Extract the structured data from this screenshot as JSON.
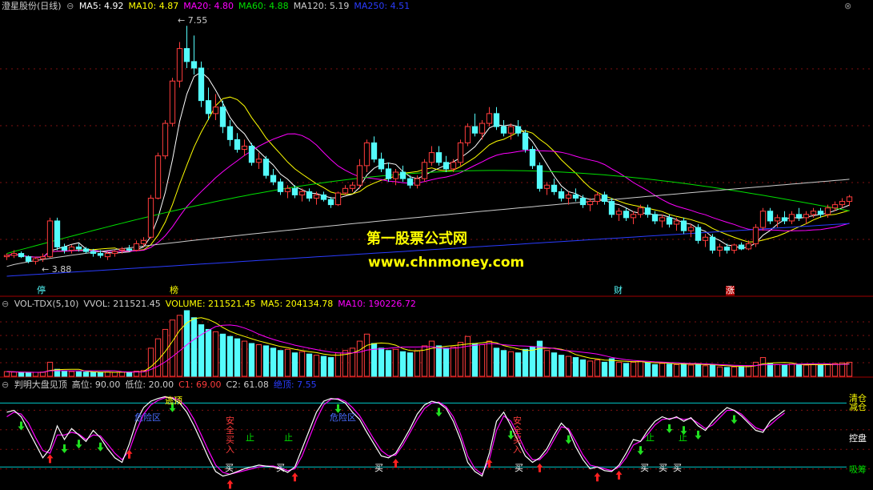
{
  "title": "澄星股份(日线)",
  "colors": {
    "up": "#ff3c3c",
    "down": "#54fcfc",
    "ma5": "#ffffff",
    "ma10": "#ffff00",
    "ma20": "#ff00ff",
    "ma60": "#00e000",
    "ma120": "#cccccc",
    "ma250": "#2a3cff",
    "grid": "#801010",
    "divider": "#a00000",
    "level": "#00c8c8"
  },
  "price_panel": {
    "legend": [
      {
        "label": "MA5: 4.92",
        "color": "#ffffff"
      },
      {
        "label": "MA10: 4.87",
        "color": "#ffff00"
      },
      {
        "label": "MA20: 4.80",
        "color": "#ff00ff"
      },
      {
        "label": "MA60: 4.88",
        "color": "#00e000"
      },
      {
        "label": "MA120: 5.19",
        "color": "#cccccc"
      },
      {
        "label": "MA250: 4.51",
        "color": "#2a3cff"
      }
    ],
    "high_label": "7.55",
    "low_label": "3.88",
    "watermark_title": "第一股票公式网",
    "watermark_url": "www.chnmoney.com",
    "event_tags": [
      "停",
      "榜",
      "财",
      "涨"
    ]
  },
  "volume_panel": {
    "legend": [
      {
        "label": "VOL-TDX(5,10)",
        "color": "#cccccc"
      },
      {
        "label": "VVOL: 211521.45",
        "color": "#cccccc"
      },
      {
        "label": "VOLUME: 211521.45",
        "color": "#ffff00"
      },
      {
        "label": "MA5: 204134.78",
        "color": "#ffff00"
      },
      {
        "label": "MA10: 190226.72",
        "color": "#ff00ff"
      }
    ]
  },
  "indicator_panel": {
    "legend": [
      {
        "label": "判明大盘见顶",
        "color": "#cccccc"
      },
      {
        "label": "高位: 90.00",
        "color": "#cccccc"
      },
      {
        "label": "低位: 20.00",
        "color": "#cccccc"
      },
      {
        "label": "C1: 69.00",
        "color": "#ff3c3c"
      },
      {
        "label": "C2: 61.08",
        "color": "#cccccc"
      },
      {
        "label": "绝顶: 7.55",
        "color": "#2a3cff"
      }
    ],
    "right_labels": {
      "top": "清仓",
      "top2": "减仓",
      "mid": "控盘",
      "bottom": "吸筹"
    },
    "annotations": {
      "escape_top": "逃顶",
      "danger_zone": "危险区",
      "safe_buy": "安全买入",
      "stop": "止",
      "buy": "买"
    }
  },
  "chart_data": [
    {
      "type": "candlestick",
      "title": "澄星股份(日线)",
      "y_high": 7.55,
      "y_low": 3.88,
      "ohlc": [
        [
          4.0,
          4.05,
          3.95,
          4.02
        ],
        [
          4.02,
          4.1,
          3.98,
          4.05
        ],
        [
          4.05,
          4.08,
          3.98,
          4.0
        ],
        [
          4.0,
          4.02,
          3.9,
          3.93
        ],
        [
          3.93,
          4.0,
          3.88,
          3.97
        ],
        [
          3.97,
          4.05,
          3.92,
          4.0
        ],
        [
          4.0,
          4.6,
          3.98,
          4.55
        ],
        [
          4.55,
          4.6,
          4.1,
          4.15
        ],
        [
          4.15,
          4.2,
          4.05,
          4.1
        ],
        [
          4.1,
          4.18,
          4.05,
          4.15
        ],
        [
          4.15,
          4.2,
          4.08,
          4.12
        ],
        [
          4.12,
          4.15,
          4.05,
          4.08
        ],
        [
          4.08,
          4.12,
          4.0,
          4.05
        ],
        [
          4.05,
          4.1,
          3.98,
          4.02
        ],
        [
          4.0,
          4.08,
          3.95,
          4.05
        ],
        [
          4.05,
          4.1,
          4.0,
          4.08
        ],
        [
          4.1,
          4.15,
          4.05,
          4.12
        ],
        [
          4.12,
          4.18,
          4.08,
          4.1
        ],
        [
          4.1,
          4.25,
          4.08,
          4.2
        ],
        [
          4.2,
          4.3,
          4.15,
          4.25
        ],
        [
          4.3,
          4.95,
          4.28,
          4.9
        ],
        [
          4.9,
          5.6,
          4.88,
          5.55
        ],
        [
          5.55,
          6.1,
          5.5,
          6.05
        ],
        [
          6.05,
          6.75,
          6.0,
          6.7
        ],
        [
          6.7,
          7.3,
          6.6,
          7.2
        ],
        [
          7.2,
          7.55,
          6.9,
          7.0
        ],
        [
          7.0,
          7.4,
          6.8,
          6.9
        ],
        [
          6.9,
          7.0,
          6.3,
          6.4
        ],
        [
          6.4,
          6.6,
          6.1,
          6.2
        ],
        [
          6.2,
          6.5,
          6.1,
          6.3
        ],
        [
          6.3,
          6.4,
          5.9,
          6.0
        ],
        [
          6.0,
          6.1,
          5.7,
          5.8
        ],
        [
          5.8,
          5.9,
          5.6,
          5.65
        ],
        [
          5.65,
          5.8,
          5.55,
          5.7
        ],
        [
          5.7,
          5.75,
          5.4,
          5.45
        ],
        [
          5.45,
          5.6,
          5.35,
          5.5
        ],
        [
          5.5,
          5.55,
          5.2,
          5.25
        ],
        [
          5.25,
          5.35,
          5.1,
          5.15
        ],
        [
          5.15,
          5.2,
          4.95,
          5.0
        ],
        [
          5.0,
          5.1,
          4.9,
          5.05
        ],
        [
          5.05,
          5.1,
          4.9,
          4.95
        ],
        [
          4.95,
          5.05,
          4.85,
          5.0
        ],
        [
          5.0,
          5.05,
          4.85,
          4.9
        ],
        [
          4.9,
          5.0,
          4.8,
          4.95
        ],
        [
          4.95,
          5.0,
          4.85,
          4.88
        ],
        [
          4.88,
          4.92,
          4.75,
          4.8
        ],
        [
          4.8,
          5.0,
          4.78,
          4.98
        ],
        [
          4.98,
          5.1,
          4.95,
          5.05
        ],
        [
          5.05,
          5.15,
          5.0,
          5.1
        ],
        [
          5.1,
          5.5,
          5.05,
          5.4
        ],
        [
          5.4,
          5.8,
          5.3,
          5.75
        ],
        [
          5.75,
          5.85,
          5.45,
          5.5
        ],
        [
          5.5,
          5.6,
          5.3,
          5.35
        ],
        [
          5.35,
          5.45,
          5.15,
          5.2
        ],
        [
          5.2,
          5.35,
          5.1,
          5.3
        ],
        [
          5.3,
          5.4,
          5.15,
          5.2
        ],
        [
          5.2,
          5.25,
          5.05,
          5.1
        ],
        [
          5.1,
          5.25,
          5.05,
          5.2
        ],
        [
          5.2,
          5.5,
          5.15,
          5.45
        ],
        [
          5.45,
          5.7,
          5.4,
          5.6
        ],
        [
          5.6,
          5.7,
          5.4,
          5.45
        ],
        [
          5.45,
          5.55,
          5.3,
          5.35
        ],
        [
          5.35,
          5.5,
          5.3,
          5.45
        ],
        [
          5.45,
          5.8,
          5.4,
          5.75
        ],
        [
          5.75,
          6.05,
          5.7,
          6.0
        ],
        [
          6.0,
          6.2,
          5.85,
          5.9
        ],
        [
          5.9,
          6.1,
          5.8,
          6.05
        ],
        [
          6.05,
          6.3,
          6.0,
          6.2
        ],
        [
          6.2,
          6.3,
          5.95,
          6.0
        ],
        [
          6.0,
          6.1,
          5.85,
          5.9
        ],
        [
          5.9,
          6.05,
          5.8,
          6.0
        ],
        [
          6.0,
          6.1,
          5.85,
          5.9
        ],
        [
          5.9,
          5.95,
          5.6,
          5.65
        ],
        [
          5.65,
          5.7,
          5.35,
          5.4
        ],
        [
          5.4,
          5.45,
          5.0,
          5.05
        ],
        [
          5.05,
          5.15,
          4.95,
          5.1
        ],
        [
          5.1,
          5.2,
          4.95,
          5.0
        ],
        [
          5.0,
          5.05,
          4.85,
          4.9
        ],
        [
          4.9,
          5.0,
          4.8,
          4.95
        ],
        [
          4.95,
          5.05,
          4.85,
          4.9
        ],
        [
          4.9,
          4.95,
          4.75,
          4.8
        ],
        [
          4.8,
          4.9,
          4.7,
          4.85
        ],
        [
          4.85,
          5.0,
          4.8,
          4.95
        ],
        [
          4.95,
          5.0,
          4.8,
          4.85
        ],
        [
          4.85,
          4.9,
          4.6,
          4.65
        ],
        [
          4.65,
          4.75,
          4.55,
          4.7
        ],
        [
          4.7,
          4.75,
          4.55,
          4.6
        ],
        [
          4.6,
          4.7,
          4.5,
          4.65
        ],
        [
          4.65,
          4.8,
          4.6,
          4.75
        ],
        [
          4.75,
          4.8,
          4.6,
          4.65
        ],
        [
          4.65,
          4.7,
          4.5,
          4.55
        ],
        [
          4.55,
          4.65,
          4.45,
          4.6
        ],
        [
          4.6,
          4.65,
          4.45,
          4.5
        ],
        [
          4.5,
          4.6,
          4.4,
          4.55
        ],
        [
          4.55,
          4.6,
          4.35,
          4.4
        ],
        [
          4.4,
          4.5,
          4.3,
          4.45
        ],
        [
          4.45,
          4.5,
          4.2,
          4.25
        ],
        [
          4.25,
          4.35,
          4.15,
          4.3
        ],
        [
          4.3,
          4.35,
          4.05,
          4.1
        ],
        [
          4.1,
          4.2,
          4.0,
          4.15
        ],
        [
          4.15,
          4.2,
          4.05,
          4.1
        ],
        [
          4.1,
          4.2,
          4.05,
          4.18
        ],
        [
          4.18,
          4.22,
          4.1,
          4.12
        ],
        [
          4.12,
          4.25,
          4.1,
          4.2
        ],
        [
          4.2,
          4.5,
          4.15,
          4.45
        ],
        [
          4.45,
          4.75,
          4.4,
          4.7
        ],
        [
          4.7,
          4.75,
          4.5,
          4.55
        ],
        [
          4.55,
          4.65,
          4.45,
          4.6
        ],
        [
          4.6,
          4.7,
          4.5,
          4.55
        ],
        [
          4.55,
          4.7,
          4.5,
          4.65
        ],
        [
          4.65,
          4.75,
          4.55,
          4.6
        ],
        [
          4.6,
          4.7,
          4.5,
          4.65
        ],
        [
          4.65,
          4.75,
          4.6,
          4.7
        ],
        [
          4.7,
          4.75,
          4.6,
          4.65
        ],
        [
          4.65,
          4.8,
          4.6,
          4.75
        ],
        [
          4.75,
          4.85,
          4.7,
          4.8
        ],
        [
          4.8,
          4.9,
          4.75,
          4.85
        ],
        [
          4.85,
          4.95,
          4.78,
          4.92
        ]
      ]
    },
    {
      "type": "bar",
      "title": "VOL-TDX(5,10)",
      "last": 211521.45,
      "ma5": 204134.78,
      "ma10": 190226.72,
      "values": [
        20,
        18,
        16,
        15,
        17,
        18,
        60,
        30,
        22,
        20,
        19,
        18,
        17,
        16,
        18,
        17,
        19,
        18,
        22,
        25,
        120,
        160,
        200,
        240,
        260,
        280,
        250,
        220,
        200,
        190,
        180,
        170,
        160,
        150,
        140,
        135,
        130,
        120,
        110,
        115,
        100,
        105,
        95,
        90,
        85,
        80,
        100,
        110,
        120,
        150,
        180,
        140,
        120,
        110,
        115,
        105,
        100,
        110,
        130,
        150,
        130,
        120,
        125,
        145,
        170,
        140,
        135,
        150,
        120,
        110,
        105,
        100,
        115,
        125,
        150,
        110,
        100,
        90,
        85,
        80,
        70,
        65,
        70,
        60,
        75,
        60,
        55,
        60,
        65,
        58,
        50,
        55,
        52,
        50,
        55,
        48,
        52,
        45,
        50,
        40,
        38,
        40,
        42,
        45,
        60,
        80,
        55,
        50,
        48,
        52,
        50,
        48,
        50,
        47,
        52,
        55,
        58,
        60
      ]
    },
    {
      "type": "line",
      "title": "判明大盘见顶",
      "levels": {
        "高位": 90,
        "低位": 20
      },
      "C1": 69.0,
      "C2": 61.08,
      "绝顶": 7.55,
      "series": [
        {
          "values": [
            80,
            82,
            75,
            60,
            45,
            30,
            40,
            65,
            50,
            62,
            55,
            48,
            60,
            52,
            40,
            30,
            25,
            45,
            70,
            85,
            92,
            95,
            97,
            95,
            90,
            80,
            65,
            48,
            30,
            15,
            10,
            12,
            15,
            18,
            20,
            22,
            21,
            20,
            18,
            14,
            20,
            40,
            60,
            80,
            92,
            95,
            94,
            90,
            80,
            72,
            58,
            45,
            32,
            30,
            35,
            48,
            62,
            78,
            88,
            92,
            90,
            84,
            70,
            50,
            25,
            15,
            10,
            35,
            70,
            80,
            65,
            48,
            32,
            25,
            30,
            40,
            55,
            68,
            60,
            42,
            28,
            18,
            20,
            16,
            15,
            22,
            35,
            50,
            48,
            60,
            70,
            75,
            72,
            75,
            70,
            74,
            65,
            60,
            70,
            78,
            85,
            82,
            76,
            68,
            60,
            58,
            70,
            76,
            82
          ]
        },
        {
          "values": [
            75,
            80,
            78,
            68,
            52,
            38,
            35,
            55,
            55,
            58,
            56,
            50,
            55,
            54,
            45,
            35,
            28,
            38,
            60,
            78,
            88,
            93,
            96,
            96,
            93,
            85,
            72,
            55,
            38,
            22,
            14,
            12,
            14,
            16,
            18,
            20,
            21,
            21,
            19,
            16,
            18,
            32,
            52,
            72,
            88,
            94,
            95,
            92,
            85,
            76,
            63,
            50,
            38,
            32,
            33,
            44,
            58,
            72,
            84,
            90,
            91,
            86,
            75,
            56,
            32,
            18,
            12,
            28,
            60,
            76,
            70,
            55,
            38,
            28,
            28,
            36,
            50,
            64,
            62,
            48,
            33,
            22,
            20,
            18,
            16,
            20,
            30,
            44,
            48,
            56,
            66,
            72,
            73,
            74,
            72,
            73,
            68,
            62,
            66,
            74,
            82,
            82,
            78,
            70,
            63,
            60,
            66,
            73,
            79
          ]
        }
      ]
    }
  ]
}
